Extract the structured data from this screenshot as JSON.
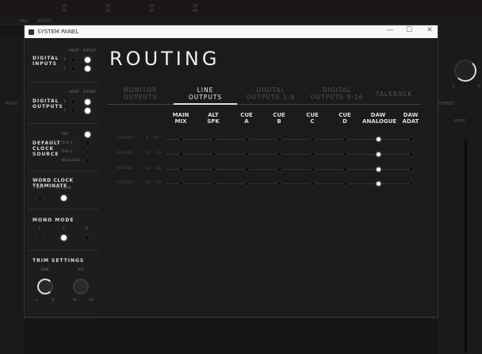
{
  "background": {
    "strip_labels": [
      "PAD",
      "BOOST",
      "10",
      "20",
      "10",
      "20",
      "10",
      "20",
      "10",
      "40"
    ],
    "side_labels": [
      "MONO",
      "STEREO",
      "MUTE"
    ],
    "knob_labels": [
      "L",
      "R"
    ]
  },
  "window": {
    "title": "SYSTEM PANEL",
    "minimize": "—",
    "maximize": "☐",
    "close": "✕"
  },
  "sidebar": {
    "digital_inputs": {
      "title_1": "DIGITAL",
      "title_2": "INPUTS",
      "col_a": "ADAT",
      "col_b": "S/PDIF",
      "rows": [
        "1",
        "2"
      ],
      "selected": "S/PDIF"
    },
    "digital_outputs": {
      "title_1": "DIGITAL",
      "title_2": "OUTPUTS",
      "col_a": "ADAT",
      "col_b": "S/PDIF",
      "rows": [
        "1",
        "2"
      ],
      "selected": "S/PDIF"
    },
    "clock_source": {
      "title_1": "DEFAULT",
      "title_2": "CLOCK",
      "title_3": "SOURCE",
      "options": [
        "INT",
        "DIG 1",
        "DIG 2",
        "W/CLOCK"
      ],
      "selected": "INT"
    },
    "word_clock": {
      "title": "WORD CLOCK TERMINATE",
      "options": [
        "OFF",
        "75 OHM"
      ],
      "selected": "75 OHM"
    },
    "mono_mode": {
      "title": "MONO MODE",
      "options": [
        "L",
        "C",
        "R"
      ],
      "selected": "C"
    },
    "trim": {
      "title": "TRIM SETTINGS",
      "dim": "DIM",
      "alt": "ALT",
      "dim_min": "-∞",
      "dim_max": "0",
      "alt_min": "-6",
      "alt_max": "+6"
    }
  },
  "main": {
    "title": "ROUTING",
    "tabs": [
      {
        "l1": "MONITOR",
        "l2": "OUTPUTS"
      },
      {
        "l1": "LINE",
        "l2": "OUTPUTS"
      },
      {
        "l1": "DIGITAL",
        "l2": "OUTPUTS 1-8"
      },
      {
        "l1": "DIGITAL",
        "l2": "OUTPUTS 9-16"
      },
      {
        "l1": "TALKBACK",
        "l2": ""
      }
    ],
    "active_tab": 1,
    "columns": [
      {
        "l1": "MAIN",
        "l2": "MIX"
      },
      {
        "l1": "ALT",
        "l2": "SPK"
      },
      {
        "l1": "CUE",
        "l2": "A"
      },
      {
        "l1": "CUE",
        "l2": "B"
      },
      {
        "l1": "CUE",
        "l2": "C"
      },
      {
        "l1": "CUE",
        "l2": "D"
      },
      {
        "l1": "DAW",
        "l2": "ANALOGUE"
      },
      {
        "l1": "DAW",
        "l2": "ADAT"
      }
    ],
    "rows": [
      {
        "type": "STEREO",
        "range": "9 - 10",
        "selected": 6
      },
      {
        "type": "STEREO",
        "range": "11 - 12",
        "selected": 6
      },
      {
        "type": "STEREO",
        "range": "13 - 14",
        "selected": 6
      },
      {
        "type": "STEREO",
        "range": "15 - 16",
        "selected": 6
      }
    ]
  }
}
